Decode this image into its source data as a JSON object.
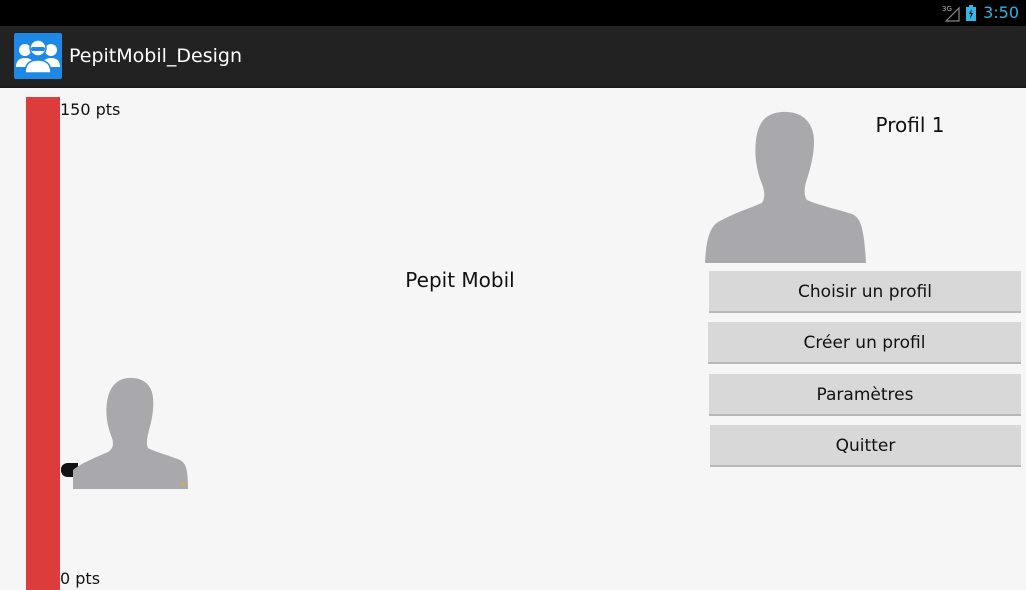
{
  "status_bar": {
    "network_label": "3G",
    "time": "3:50",
    "time_color": "#33b5e5"
  },
  "action_bar": {
    "icon": "users-group-icon",
    "title": "PepitMobil_Design"
  },
  "score": {
    "max_label": "150 pts",
    "min_label": "0 pts",
    "bar_color": "#dc3c3c"
  },
  "main": {
    "app_name": "Pepit Mobil",
    "profile_name": "Profil 1"
  },
  "menu": {
    "choose_profile": "Choisir un profil",
    "create_profile": "Créer un profil",
    "settings": "Paramètres",
    "quit": "Quitter"
  },
  "colors": {
    "action_bar_bg": "#222222",
    "button_bg": "#d8d8d8",
    "avatar_gray": "#a9a8ac"
  }
}
